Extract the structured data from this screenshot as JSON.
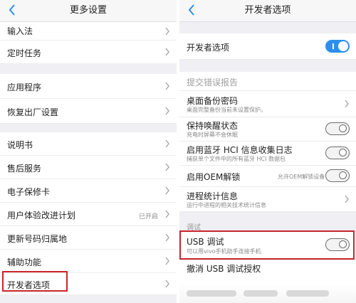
{
  "left": {
    "header": {
      "title": "更多设置"
    },
    "items": [
      {
        "label": "输入法"
      },
      {
        "label": "定时任务"
      },
      {
        "label": "应用程序"
      },
      {
        "label": "恢复出厂设置"
      },
      {
        "label": "说明书"
      },
      {
        "label": "售后服务"
      },
      {
        "label": "电子保修卡"
      },
      {
        "label": "用户体验改进计划",
        "value": "已开启"
      },
      {
        "label": "更新号码归属地"
      },
      {
        "label": "辅助功能"
      },
      {
        "label": "开发者选项"
      }
    ]
  },
  "right": {
    "header": {
      "title": "开发者选项"
    },
    "developer_toggle": {
      "label": "开发者选项",
      "state": "on"
    },
    "submit_bug_report": "提交错误报告",
    "items": [
      {
        "label": "桌面备份密码",
        "sub": "桌面完整备份当前未设置保护。"
      },
      {
        "label": "保持唤醒状态",
        "sub": "充电时屏幕不会休眠",
        "state": "off"
      },
      {
        "label": "启用蓝牙 HCI 信息收集日志",
        "sub": "捕获单个文件中的所有蓝牙 HCI 数据包",
        "state": "off"
      },
      {
        "label": "启用OEM解锁",
        "value": "允许OEM解锁设备",
        "state": "off"
      },
      {
        "label": "进程统计信息",
        "sub": "运行中进程的相关技术统计信息"
      }
    ],
    "debug_section": "调试",
    "usb_debug": {
      "label": "USB 调试",
      "sub": "可以用vivo手机助手连接手机",
      "state": "off"
    },
    "revoke_usb": "撤消 USB 调试授权"
  },
  "colors": {
    "highlight": "#c8262b",
    "accent": "#2c8ff0"
  }
}
